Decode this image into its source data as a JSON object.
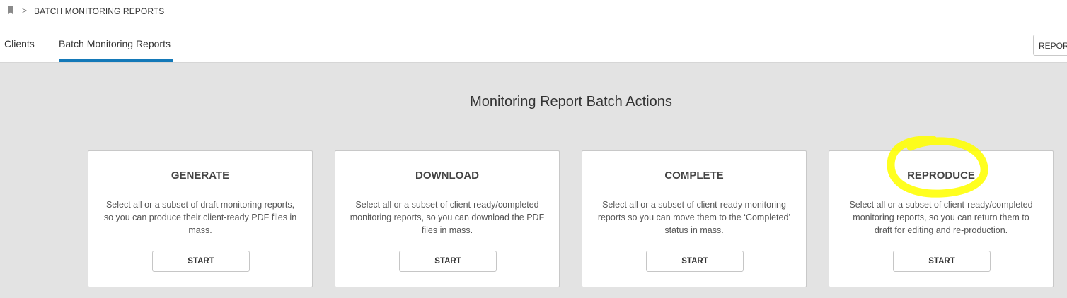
{
  "breadcrumb": {
    "separator": ">",
    "current": "BATCH MONITORING REPORTS",
    "icon": "bookmark-icon"
  },
  "tabs": [
    {
      "label": "Clients",
      "active": false
    },
    {
      "label": "Batch Monitoring Reports",
      "active": true
    }
  ],
  "header_button": {
    "label": "REPORT"
  },
  "main": {
    "title": "Monitoring Report Batch Actions"
  },
  "cards": [
    {
      "title": "GENERATE",
      "description": "Select all or a subset of draft monitoring reports, so you can produce their client-ready PDF files in mass.",
      "button": "START"
    },
    {
      "title": "DOWNLOAD",
      "description": "Select all or a subset of client-ready/completed monitoring reports, so you can download the PDF files in mass.",
      "button": "START"
    },
    {
      "title": "COMPLETE",
      "description": "Select all or a subset of client-ready monitoring reports so you can move them to the ‘Completed’ status in mass.",
      "button": "START"
    },
    {
      "title": "REPRODUCE",
      "description": "Select all or a subset of client-ready/completed monitoring reports, so you can return them to draft for editing and re-production.",
      "button": "START"
    }
  ],
  "colors": {
    "accent": "#1479b8",
    "background": "#e3e3e3",
    "highlight": "#ffff00"
  }
}
